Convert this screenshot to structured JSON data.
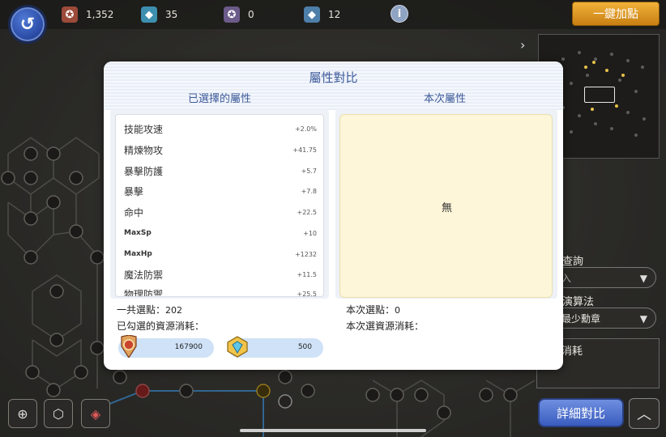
{
  "hud": {
    "resources": [
      {
        "icon": "medal-icon",
        "value": "1,352"
      },
      {
        "icon": "gem-cube-icon",
        "value": "35"
      },
      {
        "icon": "locked-medal-icon",
        "value": "0"
      },
      {
        "icon": "locked-gem-icon",
        "value": "12"
      }
    ],
    "auto_add_label": "一鍵加點"
  },
  "side_panel": {
    "query_label": "查詢",
    "input_placeholder": "入",
    "algorithm_label": "演算法",
    "algorithm_value": "最少勳章",
    "cost_label": "消耗"
  },
  "bottom_bar": {
    "detail_compare_label": "詳細對比"
  },
  "dialog": {
    "title": "屬性對比",
    "selected_header": "已選擇的屬性",
    "current_header": "本次屬性",
    "attributes": [
      {
        "name": "技能攻速",
        "value": "+2.0%"
      },
      {
        "name": "精煉物攻",
        "value": "+41.75"
      },
      {
        "name": "暴擊防護",
        "value": "+5.7"
      },
      {
        "name": "暴擊",
        "value": "+7.8"
      },
      {
        "name": "命中",
        "value": "+22.5"
      },
      {
        "name": "MaxSp",
        "value": "+10"
      },
      {
        "name": "MaxHp",
        "value": "+1232"
      },
      {
        "name": "魔法防禦",
        "value": "+11.5"
      },
      {
        "name": "物理防禦",
        "value": "+25.5"
      }
    ],
    "current_empty": "無",
    "total_points_label": "一共選點：",
    "total_points_value": "202",
    "selected_cost_label": "已勾選的資源消耗：",
    "costs": [
      {
        "icon": "medal-icon",
        "value": "167900"
      },
      {
        "icon": "gem-cube-icon",
        "value": "500"
      }
    ],
    "current_points_label": "本次選點：",
    "current_points_value": "0",
    "current_cost_label": "本次選資源消耗："
  },
  "colors": {
    "accent_blue": "#3d5a9a",
    "gold_button": "#e39a22",
    "current_box": "#fdf6d8",
    "cost_pill": "#cfe2f7"
  }
}
